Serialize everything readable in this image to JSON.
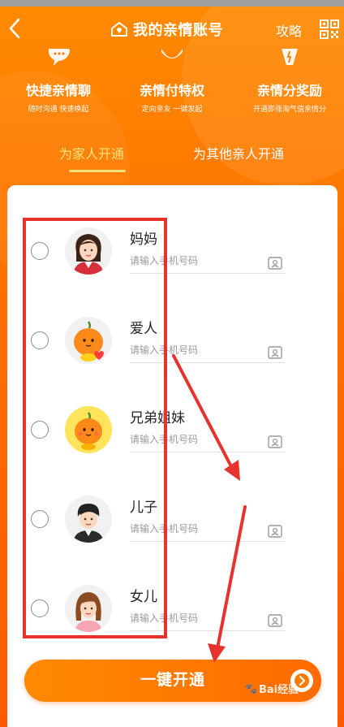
{
  "nav": {
    "title": "我的亲情账号",
    "guide_label": "攻略"
  },
  "features": [
    {
      "title": "快捷亲情聊",
      "subtitle": "随时沟通 快速唤起",
      "icon": "chat-icon"
    },
    {
      "title": "亲情付特权",
      "subtitle": "定向亲友 一键发起",
      "icon": "pay-icon"
    },
    {
      "title": "亲情分奖励",
      "subtitle": "开通即涨淘气值亲情分",
      "icon": "reward-icon"
    }
  ],
  "tabs": [
    {
      "label": "为家人开通",
      "active": true
    },
    {
      "label": "为其他亲人开通",
      "active": false
    }
  ],
  "members": [
    {
      "name": "妈妈",
      "placeholder": "请输入手机号码",
      "avatar": "mom-avatar"
    },
    {
      "name": "爱人",
      "placeholder": "请输入手机号码",
      "avatar": "spouse-avatar"
    },
    {
      "name": "兄弟姐妹",
      "placeholder": "请输入手机号码",
      "avatar": "sibling-avatar"
    },
    {
      "name": "儿子",
      "placeholder": "请输入手机号码",
      "avatar": "son-avatar"
    },
    {
      "name": "女儿",
      "placeholder": "请输入手机号码",
      "avatar": "daughter-avatar"
    }
  ],
  "cta": {
    "label": "一键开通"
  },
  "watermark": {
    "text": "Bai经验"
  },
  "colors": {
    "brand_orange": "#ff6a00",
    "tab_active": "#ffe27a",
    "annotation_red": "#e8322d"
  }
}
